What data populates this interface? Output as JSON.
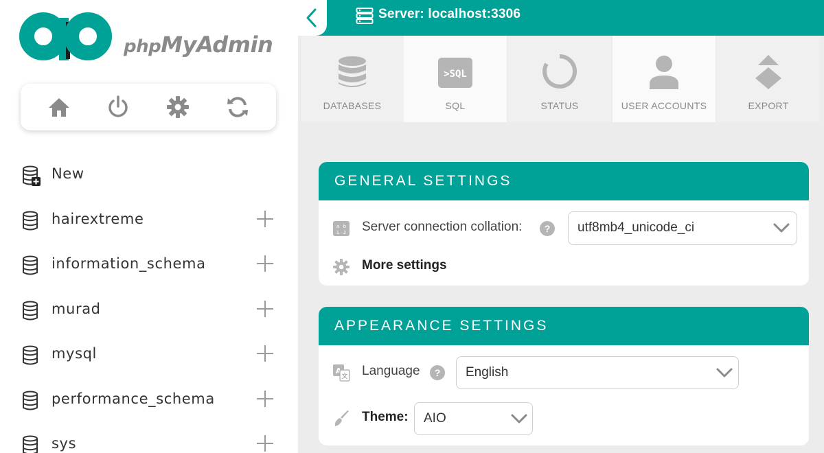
{
  "app": {
    "logo_text_php": "php",
    "logo_text_myadmin": "MyAdmin"
  },
  "sidebar": {
    "quick_links": [
      {
        "name": "home-icon"
      },
      {
        "name": "power-icon"
      },
      {
        "name": "gear-icon"
      },
      {
        "name": "refresh-icon"
      }
    ],
    "databases": [
      {
        "label": "New",
        "icon": "new-database-icon",
        "expandable": false
      },
      {
        "label": "hairextreme",
        "icon": "database-icon",
        "expandable": true
      },
      {
        "label": "information_schema",
        "icon": "database-icon",
        "expandable": true
      },
      {
        "label": "murad",
        "icon": "database-icon",
        "expandable": true
      },
      {
        "label": "mysql",
        "icon": "database-icon",
        "expandable": true
      },
      {
        "label": "performance_schema",
        "icon": "database-icon",
        "expandable": true
      },
      {
        "label": "sys",
        "icon": "database-icon",
        "expandable": true
      }
    ]
  },
  "header": {
    "server_label": "Server: localhost:3306"
  },
  "tabs": [
    {
      "label": "DATABASES",
      "icon": "database-stack-icon"
    },
    {
      "label": "SQL",
      "icon": "sql-icon"
    },
    {
      "label": "STATUS",
      "icon": "status-icon"
    },
    {
      "label": "USER ACCOUNTS",
      "icon": "user-icon"
    },
    {
      "label": "EXPORT",
      "icon": "export-icon"
    }
  ],
  "general_settings": {
    "title": "GENERAL SETTINGS",
    "collation_label": "Server connection collation:",
    "collation_value": "utf8mb4_unicode_ci",
    "more_settings": "More settings",
    "help": "?"
  },
  "appearance_settings": {
    "title": "APPEARANCE SETTINGS",
    "language_label": "Language",
    "language_value": "English",
    "theme_label": "Theme:",
    "theme_value": "AIO",
    "help": "?"
  },
  "colors": {
    "accent": "#00a197",
    "sidebar_bg": "#ffffff",
    "main_bg": "#ececec",
    "icon_gray": "#b5b5b5",
    "logo_dark": "#1d1d1d"
  }
}
